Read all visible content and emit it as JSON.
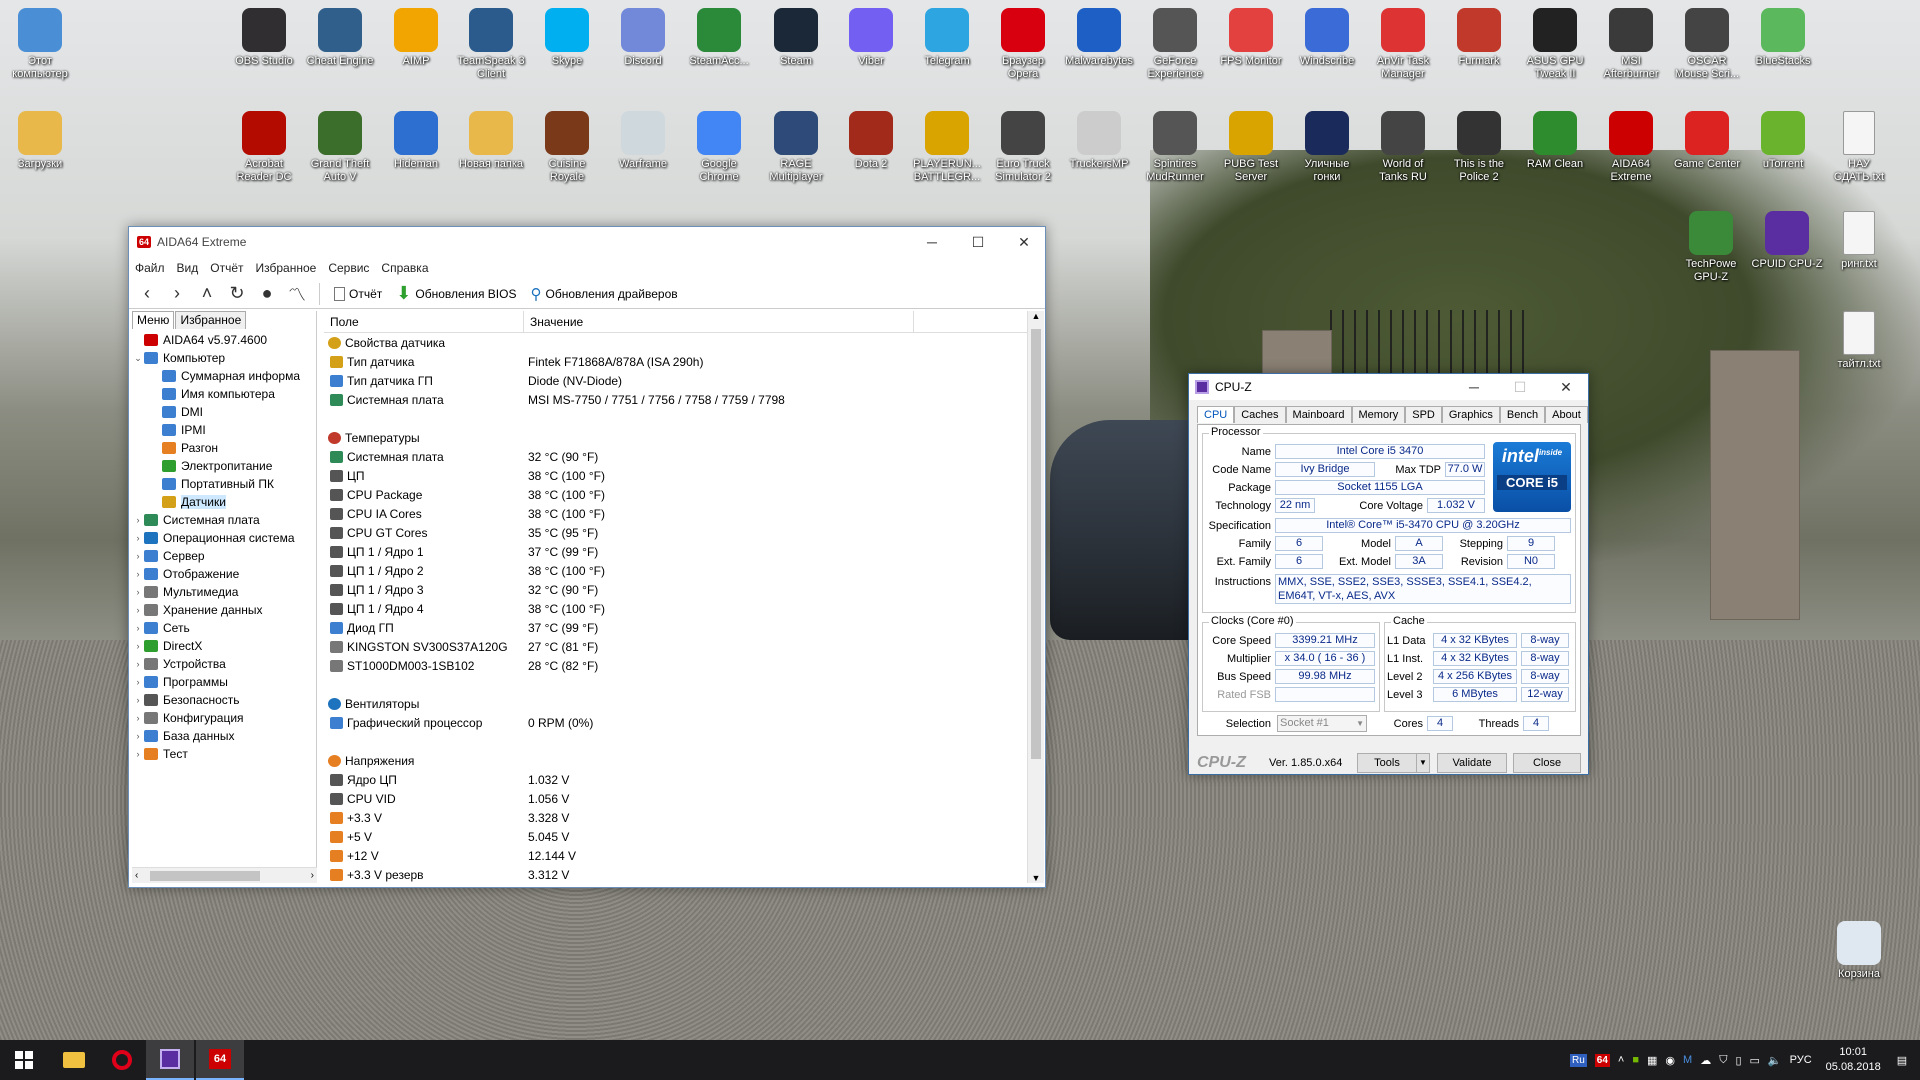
{
  "desktop_icons": [
    {
      "label": "Этот компьютер",
      "icon": "this-pc-icon",
      "color": "#4a8fd6"
    },
    {
      "label": "OBS Studio",
      "icon": "obs-icon",
      "color": "#302e31"
    },
    {
      "label": "Cheat Engine",
      "icon": "cheat-engine-icon",
      "color": "#2f5f8a"
    },
    {
      "label": "AIMP",
      "icon": "aimp-icon",
      "color": "#f2a400"
    },
    {
      "label": "TeamSpeak 3 Client",
      "icon": "teamspeak-icon",
      "color": "#2a5b8c"
    },
    {
      "label": "Skype",
      "icon": "skype-icon",
      "color": "#00aff0"
    },
    {
      "label": "Discord",
      "icon": "discord-icon",
      "color": "#7289da"
    },
    {
      "label": "SteamAcc...",
      "icon": "steamacc-icon",
      "color": "#2a8a3a"
    },
    {
      "label": "Steam",
      "icon": "steam-icon",
      "color": "#1b2838"
    },
    {
      "label": "Viber",
      "icon": "viber-icon",
      "color": "#7360f2"
    },
    {
      "label": "Telegram",
      "icon": "telegram-icon",
      "color": "#2ca5e0"
    },
    {
      "label": "Браузер Opera",
      "icon": "opera-icon",
      "color": "#d8000f"
    },
    {
      "label": "Malwarebytes",
      "icon": "malwarebytes-icon",
      "color": "#1d5fc4"
    },
    {
      "label": "GeForce Experience",
      "icon": "geforce-icon",
      "color": "#555"
    },
    {
      "label": "FPS Monitor",
      "icon": "fps-monitor-icon",
      "color": "#e34040"
    },
    {
      "label": "Windscribe",
      "icon": "windscribe-icon",
      "color": "#3a6bd6"
    },
    {
      "label": "AnVir Task Manager",
      "icon": "anvir-icon",
      "color": "#d33"
    },
    {
      "label": "Furmark",
      "icon": "furmark-icon",
      "color": "#c0392b"
    },
    {
      "label": "ASUS GPU Tweak II",
      "icon": "asus-gpu-icon",
      "color": "#222"
    },
    {
      "label": "MSI Afterburner",
      "icon": "msi-afterburner-icon",
      "color": "#3a3a3a"
    },
    {
      "label": "OSCAR Mouse Scri...",
      "icon": "oscar-icon",
      "color": "#444"
    },
    {
      "label": "BlueStacks",
      "icon": "bluestacks-icon",
      "color": "#5cb85c"
    },
    {
      "label": "Загрузки",
      "icon": "downloads-folder-icon",
      "color": "#e8b94a"
    },
    {
      "label": "Acrobat Reader DC",
      "icon": "acrobat-icon",
      "color": "#b30b00"
    },
    {
      "label": "Grand Theft Auto V",
      "icon": "gta-icon",
      "color": "#3b6e2b"
    },
    {
      "label": "Hideman",
      "icon": "hideman-icon",
      "color": "#2c6fd1"
    },
    {
      "label": "Новая папка",
      "icon": "new-folder-icon",
      "color": "#e8b94a"
    },
    {
      "label": "Cuisine Royale",
      "icon": "cuisine-royale-icon",
      "color": "#7a3a1a"
    },
    {
      "label": "Warframe",
      "icon": "warframe-icon",
      "color": "#cfd8dc"
    },
    {
      "label": "Google Chrome",
      "icon": "chrome-icon",
      "color": "#4285f4"
    },
    {
      "label": "RAGE Multiplayer",
      "icon": "rage-icon",
      "color": "#2d4a78"
    },
    {
      "label": "Dota 2",
      "icon": "dota-icon",
      "color": "#a12a1a"
    },
    {
      "label": "PLAYERUN... BATTLEGR...",
      "icon": "pubg-icon",
      "color": "#d9a400"
    },
    {
      "label": "Euro Truck Simulator 2",
      "icon": "ets2-icon",
      "color": "#444"
    },
    {
      "label": "TruckersMP",
      "icon": "truckersmp-icon",
      "color": "#ccc"
    },
    {
      "label": "Spintires MudRunner",
      "icon": "mudrunner-icon",
      "color": "#555"
    },
    {
      "label": "PUBG Test Server",
      "icon": "pubg-test-icon",
      "color": "#d9a400"
    },
    {
      "label": "Уличные гонки",
      "icon": "street-racing-icon",
      "color": "#1a2a5a"
    },
    {
      "label": "World of Tanks RU",
      "icon": "wot-icon",
      "color": "#444"
    },
    {
      "label": "This is the Police 2",
      "icon": "police-icon",
      "color": "#333"
    },
    {
      "label": "RAM Clean",
      "icon": "ram-clean-icon",
      "color": "#2e8b2e"
    },
    {
      "label": "AIDA64 Extreme",
      "icon": "aida64-icon",
      "color": "#c00"
    },
    {
      "label": "Game Center",
      "icon": "game-center-icon",
      "color": "#d22"
    },
    {
      "label": "uTorrent",
      "icon": "utorrent-icon",
      "color": "#6ab42d"
    },
    {
      "label": "НАУ СДАТЬ.txt",
      "icon": "text-file-icon",
      "color": "#f5f5f5"
    },
    {
      "label": "TechPowe GPU-Z",
      "icon": "gpuz-icon",
      "color": "#3a8a3a"
    },
    {
      "label": "CPUID CPU-Z",
      "icon": "cpuz-icon",
      "color": "#5a2ea0"
    },
    {
      "label": "ринг.txt",
      "icon": "text-file-icon",
      "color": "#f5f5f5"
    },
    {
      "label": "тайтл.txt",
      "icon": "text-file-icon",
      "color": "#f5f5f5"
    },
    {
      "label": "Корзина",
      "icon": "recycle-bin-icon",
      "color": "#dfe8f0"
    }
  ],
  "aida": {
    "title": "AIDA64 Extreme",
    "app_icon": "64",
    "menu": [
      "Файл",
      "Вид",
      "Отчёт",
      "Избранное",
      "Сервис",
      "Справка"
    ],
    "toolbar": {
      "report": "Отчёт",
      "bios_update": "Обновления BIOS",
      "driver_update": "Обновления драйверов"
    },
    "left_tabs": [
      "Меню",
      "Избранное"
    ],
    "tree": [
      {
        "label": "AIDA64 v5.97.4600",
        "level": 0,
        "exp": "",
        "color": "#c00"
      },
      {
        "label": "Компьютер",
        "level": 0,
        "exp": "⌄",
        "color": "#3c7fd0"
      },
      {
        "label": "Суммарная информа",
        "level": 1,
        "exp": "",
        "color": "#3c7fd0"
      },
      {
        "label": "Имя компьютера",
        "level": 1,
        "exp": "",
        "color": "#3c7fd0"
      },
      {
        "label": "DMI",
        "level": 1,
        "exp": "",
        "color": "#3c7fd0"
      },
      {
        "label": "IPMI",
        "level": 1,
        "exp": "",
        "color": "#3c7fd0"
      },
      {
        "label": "Разгон",
        "level": 1,
        "exp": "",
        "color": "#e67e22"
      },
      {
        "label": "Электропитание",
        "level": 1,
        "exp": "",
        "color": "#2e9e2e"
      },
      {
        "label": "Портативный ПК",
        "level": 1,
        "exp": "",
        "color": "#3c7fd0"
      },
      {
        "label": "Датчики",
        "level": 1,
        "exp": "",
        "color": "#d4a017",
        "selected": true
      },
      {
        "label": "Системная плата",
        "level": 0,
        "exp": "›",
        "color": "#2e8b57"
      },
      {
        "label": "Операционная система",
        "level": 0,
        "exp": "›",
        "color": "#1e73be"
      },
      {
        "label": "Сервер",
        "level": 0,
        "exp": "›",
        "color": "#3c7fd0"
      },
      {
        "label": "Отображение",
        "level": 0,
        "exp": "›",
        "color": "#3c7fd0"
      },
      {
        "label": "Мультимедиа",
        "level": 0,
        "exp": "›",
        "color": "#777"
      },
      {
        "label": "Хранение данных",
        "level": 0,
        "exp": "›",
        "color": "#777"
      },
      {
        "label": "Сеть",
        "level": 0,
        "exp": "›",
        "color": "#3c7fd0"
      },
      {
        "label": "DirectX",
        "level": 0,
        "exp": "›",
        "color": "#2e9e2e"
      },
      {
        "label": "Устройства",
        "level": 0,
        "exp": "›",
        "color": "#777"
      },
      {
        "label": "Программы",
        "level": 0,
        "exp": "›",
        "color": "#3c7fd0"
      },
      {
        "label": "Безопасность",
        "level": 0,
        "exp": "›",
        "color": "#555"
      },
      {
        "label": "Конфигурация",
        "level": 0,
        "exp": "›",
        "color": "#777"
      },
      {
        "label": "База данных",
        "level": 0,
        "exp": "›",
        "color": "#3c7fd0"
      },
      {
        "label": "Тест",
        "level": 0,
        "exp": "›",
        "color": "#e67e22"
      }
    ],
    "columns": [
      "Поле",
      "Значение"
    ],
    "rows": [
      {
        "type": "grp",
        "field": "Свойства датчика",
        "value": "",
        "color": "#d4a017"
      },
      {
        "type": "row",
        "field": "Тип датчика",
        "value": "Fintek F71868A/878A  (ISA 290h)",
        "color": "#d4a017"
      },
      {
        "type": "row",
        "field": "Тип датчика ГП",
        "value": "Diode  (NV-Diode)",
        "color": "#3c7fd0"
      },
      {
        "type": "row",
        "field": "Системная плата",
        "value": "MSI MS-7750 / 7751 / 7756 / 7758 / 7759 / 7798",
        "color": "#2e8b57"
      },
      {
        "type": "gap"
      },
      {
        "type": "grp",
        "field": "Температуры",
        "value": "",
        "color": "#c0392b"
      },
      {
        "type": "row",
        "field": "Системная плата",
        "value": "32 °C  (90 °F)",
        "color": "#2e8b57"
      },
      {
        "type": "row",
        "field": "ЦП",
        "value": "38 °C  (100 °F)",
        "color": "#555"
      },
      {
        "type": "row",
        "field": "CPU Package",
        "value": "38 °C  (100 °F)",
        "color": "#555"
      },
      {
        "type": "row",
        "field": "CPU IA Cores",
        "value": "38 °C  (100 °F)",
        "color": "#555"
      },
      {
        "type": "row",
        "field": "CPU GT Cores",
        "value": "35 °C  (95 °F)",
        "color": "#555"
      },
      {
        "type": "row",
        "field": "ЦП 1 / Ядро 1",
        "value": "37 °C  (99 °F)",
        "color": "#555"
      },
      {
        "type": "row",
        "field": "ЦП 1 / Ядро 2",
        "value": "38 °C  (100 °F)",
        "color": "#555"
      },
      {
        "type": "row",
        "field": "ЦП 1 / Ядро 3",
        "value": "32 °C  (90 °F)",
        "color": "#555"
      },
      {
        "type": "row",
        "field": "ЦП 1 / Ядро 4",
        "value": "38 °C  (100 °F)",
        "color": "#555"
      },
      {
        "type": "row",
        "field": "Диод ГП",
        "value": "37 °C  (99 °F)",
        "color": "#3c7fd0"
      },
      {
        "type": "row",
        "field": "KINGSTON SV300S37A120G",
        "value": "27 °C  (81 °F)",
        "color": "#777"
      },
      {
        "type": "row",
        "field": "ST1000DM003-1SB102",
        "value": "28 °C  (82 °F)",
        "color": "#777"
      },
      {
        "type": "gap"
      },
      {
        "type": "grp",
        "field": "Вентиляторы",
        "value": "",
        "color": "#1e73be"
      },
      {
        "type": "row",
        "field": "Графический процессор",
        "value": "0 RPM  (0%)",
        "color": "#3c7fd0"
      },
      {
        "type": "gap"
      },
      {
        "type": "grp",
        "field": "Напряжения",
        "value": "",
        "color": "#e67e22"
      },
      {
        "type": "row",
        "field": "Ядро ЦП",
        "value": "1.032 V",
        "color": "#555"
      },
      {
        "type": "row",
        "field": "CPU VID",
        "value": "1.056 V",
        "color": "#555"
      },
      {
        "type": "row",
        "field": "+3.3 V",
        "value": "3.328 V",
        "color": "#e67e22"
      },
      {
        "type": "row",
        "field": "+5 V",
        "value": "5.045 V",
        "color": "#e67e22"
      },
      {
        "type": "row",
        "field": "+12 V",
        "value": "12.144 V",
        "color": "#e67e22"
      },
      {
        "type": "row",
        "field": "+3.3 V резерв",
        "value": "3.312 V",
        "color": "#e67e22"
      }
    ]
  },
  "cpuz": {
    "title": "CPU-Z",
    "tabs": [
      "CPU",
      "Caches",
      "Mainboard",
      "Memory",
      "SPD",
      "Graphics",
      "Bench",
      "About"
    ],
    "processor_group": "Processor",
    "labels": {
      "name": "Name",
      "code_name": "Code Name",
      "max_tdp": "Max TDP",
      "package": "Package",
      "technology": "Technology",
      "core_voltage": "Core Voltage",
      "specification": "Specification",
      "family": "Family",
      "model": "Model",
      "stepping": "Stepping",
      "ext_family": "Ext. Family",
      "ext_model": "Ext. Model",
      "revision": "Revision",
      "instructions": "Instructions"
    },
    "values": {
      "name": "Intel Core i5 3470",
      "code_name": "Ivy Bridge",
      "max_tdp": "77.0 W",
      "package": "Socket 1155 LGA",
      "technology": "22 nm",
      "core_voltage": "1.032 V",
      "specification": "Intel® Core™ i5-3470 CPU @ 3.20GHz",
      "family": "6",
      "model": "A",
      "stepping": "9",
      "ext_family": "6",
      "ext_model": "3A",
      "revision": "N0",
      "instructions": "MMX, SSE, SSE2, SSE3, SSSE3, SSE4.1, SSE4.2, EM64T, VT-x, AES, AVX"
    },
    "intel_logo": {
      "brand": "intel",
      "inside": "inside",
      "tier": "CORE i5"
    },
    "clocks_group": "Clocks (Core #0)",
    "clocks": {
      "core_speed_l": "Core Speed",
      "core_speed": "3399.21 MHz",
      "multiplier_l": "Multiplier",
      "multiplier": "x 34.0 ( 16 - 36 )",
      "bus_speed_l": "Bus Speed",
      "bus_speed": "99.98 MHz",
      "rated_fsb_l": "Rated FSB",
      "rated_fsb": ""
    },
    "cache_group": "Cache",
    "cache": [
      {
        "label": "L1 Data",
        "size": "4 x 32 KBytes",
        "way": "8-way"
      },
      {
        "label": "L1 Inst.",
        "size": "4 x 32 KBytes",
        "way": "8-way"
      },
      {
        "label": "Level 2",
        "size": "4 x 256 KBytes",
        "way": "8-way"
      },
      {
        "label": "Level 3",
        "size": "6 MBytes",
        "way": "12-way"
      }
    ],
    "selection_l": "Selection",
    "selection": "Socket #1",
    "cores_l": "Cores",
    "cores": "4",
    "threads_l": "Threads",
    "threads": "4",
    "brand": "CPU-Z",
    "version": "Ver. 1.85.0.x64",
    "tools": "Tools",
    "validate": "Validate",
    "close": "Close"
  },
  "taskbar": {
    "tray": {
      "lang_badge": "Ru",
      "app_badge": "64",
      "lang": "РУС",
      "time": "10:01",
      "date": "05.08.2018"
    }
  }
}
